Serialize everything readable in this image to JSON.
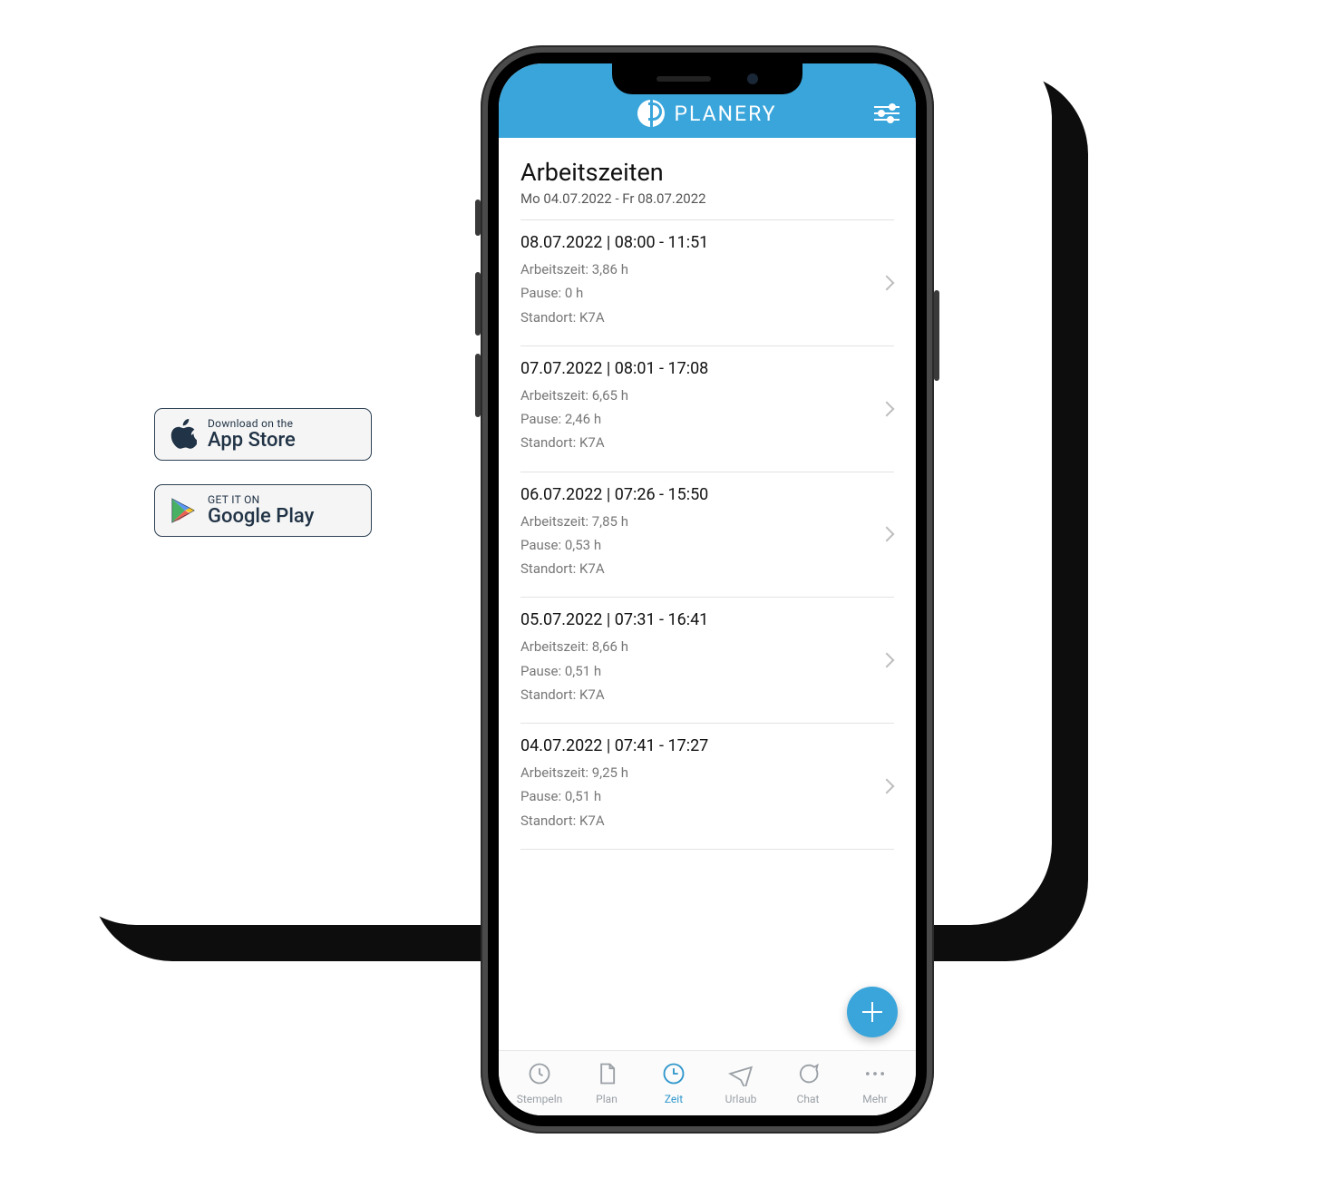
{
  "colors": {
    "accent": "#39a5db"
  },
  "badges": {
    "appstore": {
      "small": "Download on the",
      "big": "App Store"
    },
    "gplay": {
      "small": "GET IT ON",
      "big": "Google Play"
    }
  },
  "header": {
    "brand": "PLANERY"
  },
  "page": {
    "title": "Arbeitszeiten",
    "subtitle": "Mo 04.07.2022 - Fr 08.07.2022"
  },
  "labels": {
    "work": "Arbeitszeit",
    "pause": "Pause",
    "location": "Standort"
  },
  "entries": [
    {
      "title": "08.07.2022 | 08:00 - 11:51",
      "work": "3,86 h",
      "pause": "0 h",
      "location": "K7A"
    },
    {
      "title": "07.07.2022 | 08:01 - 17:08",
      "work": "6,65 h",
      "pause": "2,46 h",
      "location": "K7A"
    },
    {
      "title": "06.07.2022 | 07:26 - 15:50",
      "work": "7,85 h",
      "pause": "0,53 h",
      "location": "K7A"
    },
    {
      "title": "05.07.2022 | 07:31 - 16:41",
      "work": "8,66 h",
      "pause": "0,51 h",
      "location": "K7A"
    },
    {
      "title": "04.07.2022 | 07:41 - 17:27",
      "work": "9,25 h",
      "pause": "0,51 h",
      "location": "K7A"
    }
  ],
  "tabs": [
    {
      "id": "stempeln",
      "label": "Stempeln"
    },
    {
      "id": "plan",
      "label": "Plan"
    },
    {
      "id": "zeit",
      "label": "Zeit"
    },
    {
      "id": "urlaub",
      "label": "Urlaub"
    },
    {
      "id": "chat",
      "label": "Chat"
    },
    {
      "id": "mehr",
      "label": "Mehr"
    }
  ],
  "active_tab": "zeit"
}
